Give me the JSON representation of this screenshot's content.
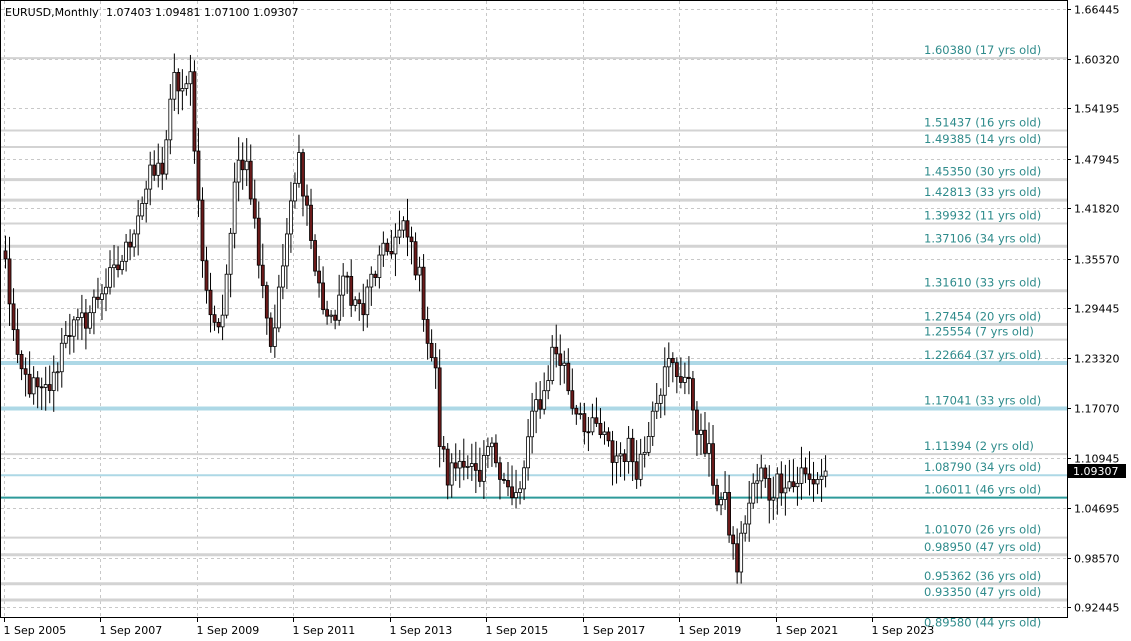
{
  "header": {
    "symbol": "EURUSD,Monthly",
    "ohlc": "1.07403 1.09481 1.07100 1.09307"
  },
  "current_price_label": "1.09307",
  "colors": {
    "background": "#ffffff",
    "grid": "#c8c8c8",
    "candle_up_fill": "#ffffff",
    "candle_down_fill": "#6b1a1a",
    "candle_outline": "#000000",
    "level_gray": "#d3d3d3",
    "level_blue": "#add8e6",
    "level_teal": "#2e9a9a",
    "level_text": "#2e8b8b",
    "price_badge": "#000000"
  },
  "chart_data": {
    "type": "candlestick",
    "title": "EURUSD,Monthly",
    "xlabel": "",
    "ylabel": "",
    "ylim": [
      0.9125,
      1.6745
    ],
    "grid": true,
    "y_ticks": [
      "1.66445",
      "1.60320",
      "1.54195",
      "1.47945",
      "1.41820",
      "1.35570",
      "1.29445",
      "1.23320",
      "1.17070",
      "1.10945",
      "1.04695",
      "0.98570",
      "0.92445"
    ],
    "x_ticks": [
      "1 Sep 2005",
      "1 Sep 2007",
      "1 Sep 2009",
      "1 Sep 2011",
      "1 Sep 2013",
      "1 Sep 2015",
      "1 Sep 2017",
      "1 Sep 2019",
      "1 Sep 2021",
      "1 Sep 2023"
    ],
    "x_tick_months": [
      0,
      24,
      48,
      72,
      96,
      120,
      144,
      168,
      192,
      216
    ],
    "start_month_label": "2005-01",
    "close_path": [
      [
        0,
        1.35
      ],
      [
        3,
        1.22
      ],
      [
        6,
        1.2
      ],
      [
        9,
        1.185
      ],
      [
        12,
        1.205
      ],
      [
        15,
        1.27
      ],
      [
        18,
        1.27
      ],
      [
        21,
        1.29
      ],
      [
        24,
        1.32
      ],
      [
        27,
        1.335
      ],
      [
        30,
        1.365
      ],
      [
        33,
        1.415
      ],
      [
        36,
        1.455
      ],
      [
        39,
        1.47
      ],
      [
        42,
        1.575
      ],
      [
        45,
        1.56
      ],
      [
        46,
        1.58
      ],
      [
        48,
        1.425
      ],
      [
        50,
        1.31
      ],
      [
        52,
        1.27
      ],
      [
        54,
        1.29
      ],
      [
        56,
        1.39
      ],
      [
        58,
        1.48
      ],
      [
        60,
        1.485
      ],
      [
        62,
        1.4
      ],
      [
        64,
        1.33
      ],
      [
        66,
        1.25
      ],
      [
        68,
        1.31
      ],
      [
        70,
        1.385
      ],
      [
        72,
        1.445
      ],
      [
        73,
        1.48
      ],
      [
        75,
        1.42
      ],
      [
        77,
        1.34
      ],
      [
        79,
        1.3
      ],
      [
        81,
        1.27
      ],
      [
        83,
        1.31
      ],
      [
        85,
        1.33
      ],
      [
        87,
        1.3
      ],
      [
        89,
        1.29
      ],
      [
        91,
        1.33
      ],
      [
        93,
        1.35
      ],
      [
        95,
        1.365
      ],
      [
        97,
        1.38
      ],
      [
        99,
        1.39
      ],
      [
        101,
        1.37
      ],
      [
        103,
        1.33
      ],
      [
        105,
        1.26
      ],
      [
        107,
        1.21
      ],
      [
        108,
        1.13
      ],
      [
        110,
        1.085
      ],
      [
        112,
        1.1
      ],
      [
        114,
        1.115
      ],
      [
        116,
        1.095
      ],
      [
        118,
        1.07
      ],
      [
        120,
        1.12
      ],
      [
        122,
        1.11
      ],
      [
        124,
        1.09
      ],
      [
        126,
        1.055
      ],
      [
        128,
        1.065
      ],
      [
        130,
        1.13
      ],
      [
        132,
        1.175
      ],
      [
        134,
        1.19
      ],
      [
        136,
        1.24
      ],
      [
        137,
        1.24
      ],
      [
        139,
        1.22
      ],
      [
        141,
        1.175
      ],
      [
        143,
        1.17
      ],
      [
        145,
        1.14
      ],
      [
        147,
        1.145
      ],
      [
        149,
        1.13
      ],
      [
        151,
        1.11
      ],
      [
        153,
        1.115
      ],
      [
        155,
        1.12
      ],
      [
        157,
        1.1
      ],
      [
        159,
        1.12
      ],
      [
        161,
        1.18
      ],
      [
        163,
        1.2
      ],
      [
        165,
        1.225
      ],
      [
        167,
        1.215
      ],
      [
        169,
        1.21
      ],
      [
        171,
        1.175
      ],
      [
        173,
        1.13
      ],
      [
        175,
        1.11
      ],
      [
        177,
        1.06
      ],
      [
        179,
        1.05
      ],
      [
        181,
        0.995
      ],
      [
        182,
        0.975
      ],
      [
        184,
        1.035
      ],
      [
        186,
        1.07
      ],
      [
        188,
        1.09
      ],
      [
        190,
        1.065
      ],
      [
        192,
        1.08
      ],
      [
        194,
        1.085
      ],
      [
        196,
        1.075
      ],
      [
        198,
        1.09
      ],
      [
        200,
        1.08
      ],
      [
        202,
        1.085
      ],
      [
        204,
        1.093
      ]
    ],
    "levels": [
      {
        "price": 1.6038,
        "label": "1.60380  (17 yrs old)",
        "style": "gray",
        "width": 2
      },
      {
        "price": 1.51437,
        "label": "1.51437  (16 yrs old)",
        "style": "gray",
        "width": 2
      },
      {
        "price": 1.49385,
        "label": "1.49385  (14 yrs old)",
        "style": "gray",
        "width": 2
      },
      {
        "price": 1.4535,
        "label": "1.45350  (30 yrs old)",
        "style": "gray",
        "width": 3
      },
      {
        "price": 1.42813,
        "label": "1.42813  (33 yrs old)",
        "style": "gray",
        "width": 3
      },
      {
        "price": 1.39932,
        "label": "1.39932  (11 yrs old)",
        "style": "gray",
        "width": 2
      },
      {
        "price": 1.37106,
        "label": "1.37106  (34 yrs old)",
        "style": "gray",
        "width": 3
      },
      {
        "price": 1.3161,
        "label": "1.31610  (33 yrs old)",
        "style": "gray",
        "width": 3
      },
      {
        "price": 1.27454,
        "label": "1.27454  (20 yrs old)",
        "style": "gray",
        "width": 3
      },
      {
        "price": 1.25554,
        "label": "1.25554  (7 yrs old)",
        "style": "gray",
        "width": 2
      },
      {
        "price": 1.22664,
        "label": "1.22664  (37 yrs old)",
        "style": "blue",
        "width": 4
      },
      {
        "price": 1.17041,
        "label": "1.17041  (33 yrs old)",
        "style": "blue",
        "width": 4
      },
      {
        "price": 1.11394,
        "label": "1.11394  (2 yrs old)",
        "style": "gray",
        "width": 2
      },
      {
        "price": 1.0879,
        "label": "1.08790  (34 yrs old)",
        "style": "blue",
        "width": 2
      },
      {
        "price": 1.06011,
        "label": "1.06011  (46 yrs old)",
        "style": "teal",
        "width": 2
      },
      {
        "price": 1.0107,
        "label": "1.01070  (26 yrs old)",
        "style": "gray",
        "width": 2
      },
      {
        "price": 0.9895,
        "label": "0.98950  (47 yrs old)",
        "style": "gray",
        "width": 3
      },
      {
        "price": 0.95362,
        "label": "0.95362  (36 yrs old)",
        "style": "gray",
        "width": 3
      },
      {
        "price": 0.9335,
        "label": "0.93350  (47 yrs old)",
        "style": "gray",
        "width": 3
      },
      {
        "price": 0.8958,
        "label": "0.89580  (44 yrs old)",
        "style": "gray",
        "width": 0
      }
    ],
    "current_price": 1.09307
  }
}
